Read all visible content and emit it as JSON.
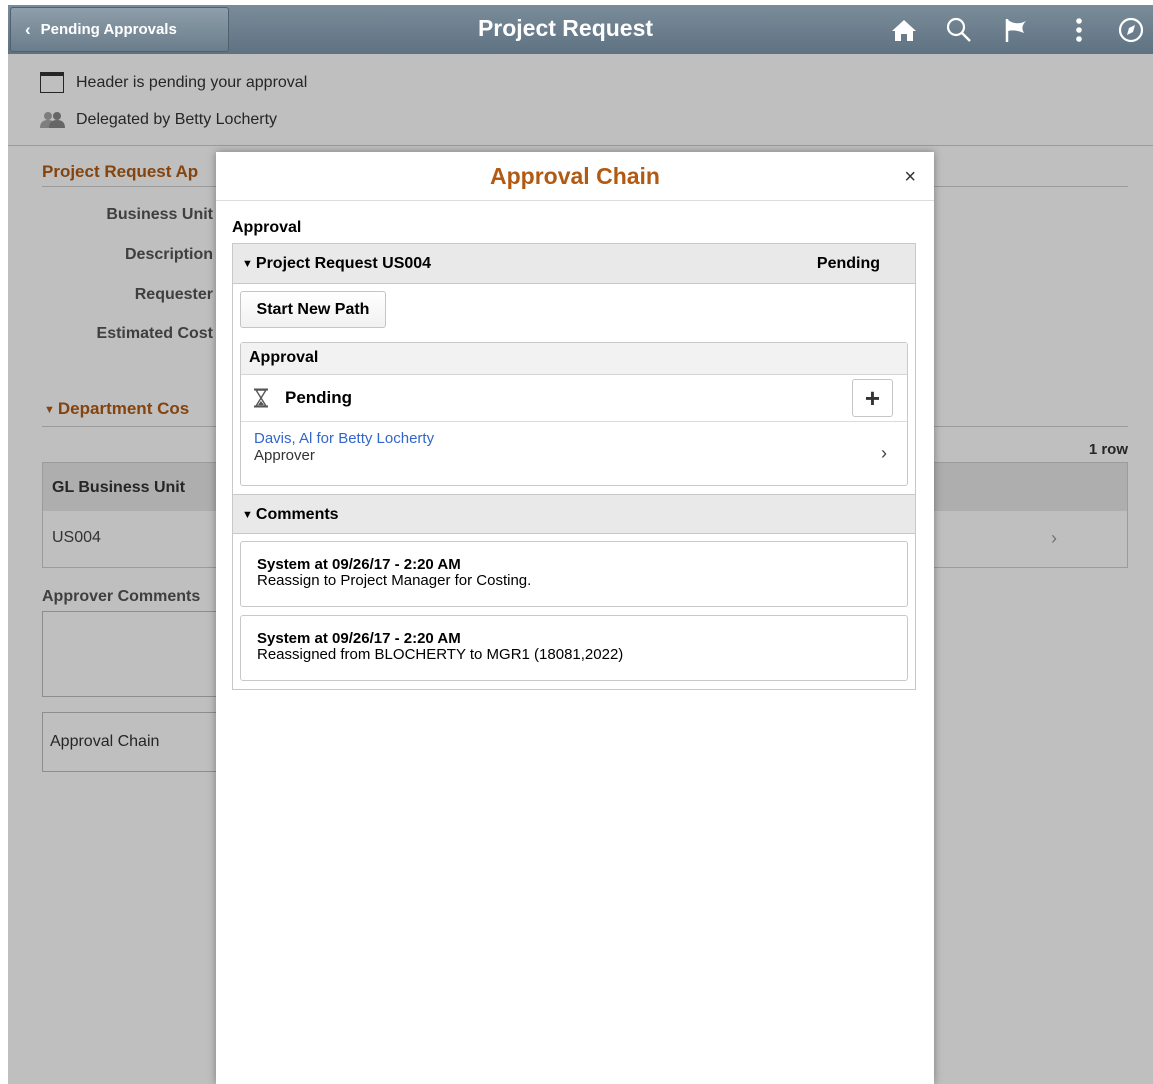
{
  "header": {
    "back_label": "Pending Approvals",
    "title": "Project Request",
    "icons": [
      "home-icon",
      "search-icon",
      "flag-icon",
      "kebab-menu-icon",
      "navbar-compass-icon"
    ]
  },
  "background": {
    "pending_text": "Header is pending your approval",
    "delegated_text": "Delegated by Betty Locherty",
    "section_title": "Project Request Ap",
    "fields": [
      "Business Unit",
      "Description",
      "Requester",
      "Estimated Cost"
    ],
    "dept_section": "Department Cos",
    "row_count": "1 row",
    "grid_header": "GL Business Unit",
    "grid_value": "US004",
    "approver_comments_label": "Approver Comments",
    "approval_chain_link": "Approval Chain"
  },
  "modal": {
    "title": "Approval Chain",
    "close": "×",
    "approval_label": "Approval",
    "request": {
      "title": "Project Request US004",
      "status": "Pending"
    },
    "start_new_path": "Start New Path",
    "step": {
      "header": "Approval",
      "status": "Pending",
      "add": "+",
      "approver_name": "Davis, Al for Betty Locherty",
      "approver_role": "Approver"
    },
    "comments_title": "Comments",
    "comments": [
      {
        "author": "System at 09/26/17 - 2:20 AM",
        "text": "Reassign to Project Manager for Costing."
      },
      {
        "author": "System at 09/26/17 - 2:20 AM",
        "text": "Reassigned from BLOCHERTY to MGR1 (18081,2022)"
      }
    ]
  }
}
